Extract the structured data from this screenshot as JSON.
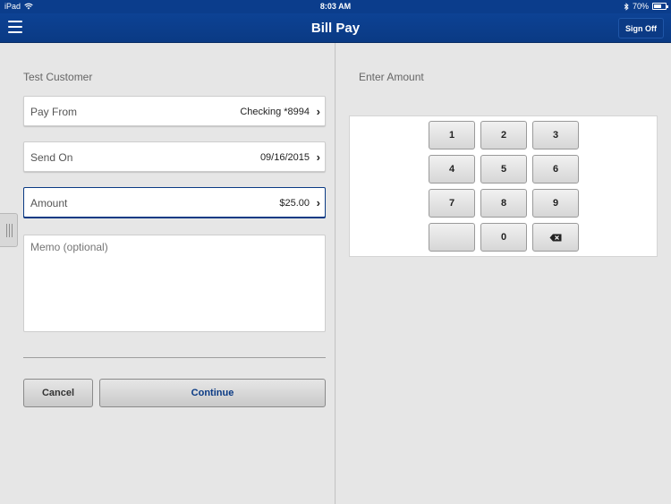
{
  "status_bar": {
    "device": "iPad",
    "time": "8:03 AM",
    "battery": "70%",
    "battery_level": 0.7
  },
  "nav": {
    "title": "Bill Pay",
    "sign_off": "Sign Off"
  },
  "form": {
    "customer_name": "Test Customer",
    "pay_from": {
      "label": "Pay From",
      "value": "Checking *8994"
    },
    "send_on": {
      "label": "Send On",
      "value": "09/16/2015"
    },
    "amount": {
      "label": "Amount",
      "value": "$25.00"
    },
    "memo_placeholder": "Memo (optional)",
    "cancel_label": "Cancel",
    "continue_label": "Continue"
  },
  "keypad": {
    "title": "Enter Amount",
    "keys": [
      "1",
      "2",
      "3",
      "4",
      "5",
      "6",
      "7",
      "8",
      "9",
      "",
      "0",
      "backspace-icon"
    ]
  },
  "colors": {
    "brand_blue": "#0a3a84",
    "background": "#e6e6e6"
  }
}
